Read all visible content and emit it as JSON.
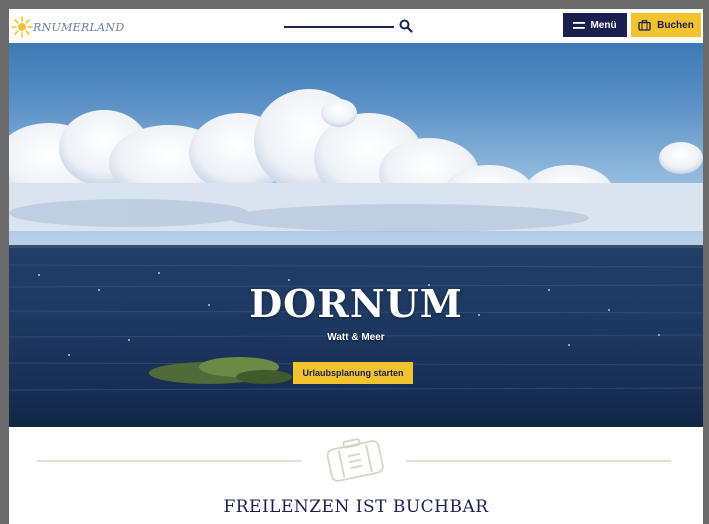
{
  "header": {
    "logo_text": "RNUMERLAND",
    "search": {
      "placeholder": ""
    },
    "menu_label": "Menü",
    "book_label": "Buchen"
  },
  "hero": {
    "title": "DORNUM",
    "subtitle": "Watt & Meer",
    "cta_label": "Urlaubsplanung starten"
  },
  "section": {
    "title": "FREILENZEN IST BUCHBAR"
  },
  "colors": {
    "navy": "#1a1f4f",
    "yellow": "#f3c22f",
    "sea": "#1e3a63",
    "sky": "#5b91c7"
  },
  "icons": {
    "logo": "sun-icon",
    "search": "search-icon",
    "menu": "hamburger-icon",
    "book": "suitcase-icon",
    "section": "suitcase-icon"
  }
}
